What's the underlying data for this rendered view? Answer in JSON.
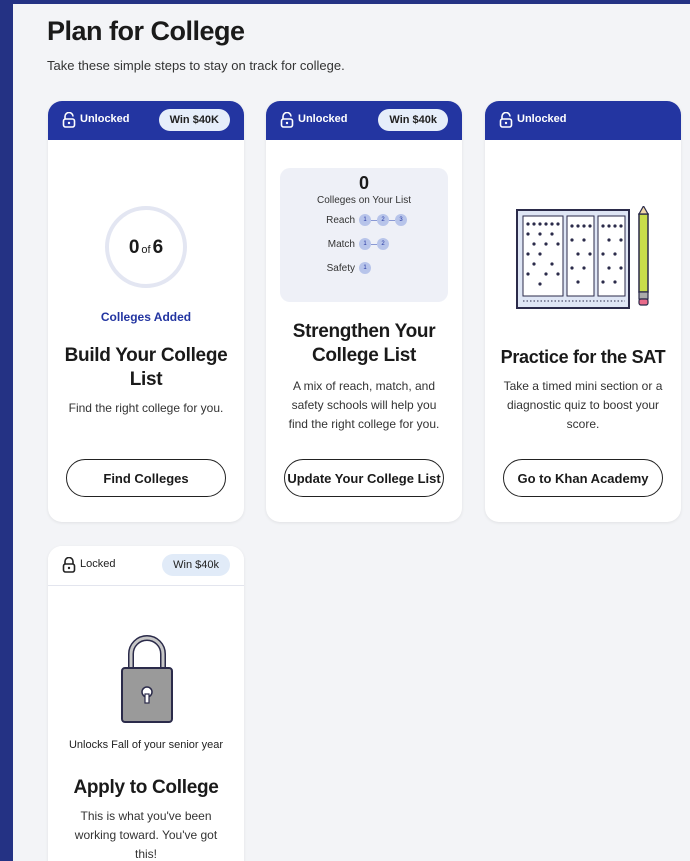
{
  "header": {
    "title": "Plan for College",
    "subtitle": "Take these simple steps to stay on track for college."
  },
  "colors": {
    "frame": "#243284",
    "card_header": "#2335a1",
    "accent": "#2335a1",
    "pill": "#e6eefa"
  },
  "cards": [
    {
      "status": "Unlocked",
      "status_icon": "unlocked-padlock-icon",
      "badge": "Win $40K",
      "progress_count": "0",
      "progress_of": "of",
      "progress_total": "6",
      "progress_label": "Colleges Added",
      "title": "Build Your College List",
      "description": "Find the right college for you.",
      "button": "Find Colleges"
    },
    {
      "status": "Unlocked",
      "status_icon": "unlocked-padlock-icon",
      "badge": "Win $40k",
      "list_count": "0",
      "list_label": "Colleges on Your List",
      "rows": [
        {
          "label": "Reach",
          "dots": [
            "1",
            "2",
            "3"
          ]
        },
        {
          "label": "Match",
          "dots": [
            "1",
            "2"
          ]
        },
        {
          "label": "Safety",
          "dots": [
            "1"
          ]
        }
      ],
      "title": "Strengthen Your College List",
      "description": "A mix of reach, match, and safety schools will help you find the right college for you.",
      "button": "Update Your College List"
    },
    {
      "status": "Unlocked",
      "status_icon": "unlocked-padlock-icon",
      "illustration": "answer-sheet-and-pencil-illustration",
      "title": "Practice for the SAT",
      "description": "Take a timed mini section or a diagnostic quiz to boost your score.",
      "button": "Go to Khan Academy"
    },
    {
      "status": "Locked",
      "status_icon": "locked-padlock-icon",
      "badge": "Win $40k",
      "illustration": "padlock-illustration",
      "unlocks_text": "Unlocks Fall of your senior year",
      "title": "Apply to College",
      "description": "This is what you've been working toward. You've got this!"
    }
  ]
}
